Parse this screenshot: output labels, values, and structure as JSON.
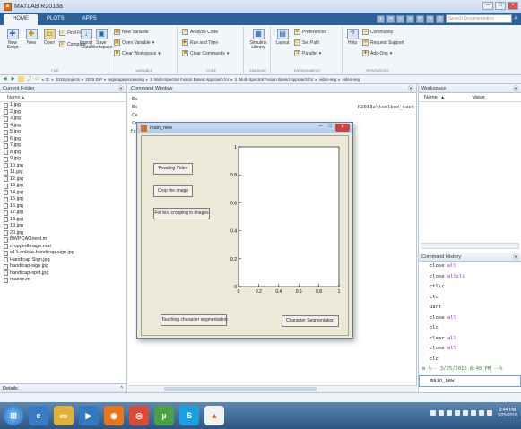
{
  "window": {
    "title": "MATLAB R2013a"
  },
  "tabs": [
    {
      "label": "HOME",
      "active": true
    },
    {
      "label": "PLOTS"
    },
    {
      "label": "APPS"
    }
  ],
  "search": {
    "placeholder": "Search Documentation"
  },
  "ribbon": {
    "new_script": "New Script",
    "new": "New",
    "open": "Open",
    "find_files": "Find Files",
    "compare": "Compare",
    "import_data": "Import Data",
    "save_workspace": "Save Workspace",
    "new_variable": "New Variable",
    "open_variable": "Open Variable",
    "clear_workspace": "Clear Workspace",
    "analyze_code": "Analyze Code",
    "run_and_time": "Run and Time",
    "clear_commands": "Clear Commands",
    "simulink_library": "Simulink Library",
    "layout": "Layout",
    "preferences": "Preferences",
    "set_path": "Set Path",
    "parallel": "Parallel",
    "help": "Help",
    "community": "Community",
    "request_support": "Request Support",
    "add_ons": "Add-Ons",
    "groups": [
      "FILE",
      "VARIABLE",
      "CODE",
      "SIMULINK",
      "ENVIRONMENT",
      "RESOURCES"
    ]
  },
  "address": {
    "crumbs": [
      "D:",
      "2016 projects",
      "2015 DIP",
      "regimageprocessing",
      "3. Multi-Spectral Fusion Based Approach for",
      "3. Multi-Spectral Fusion Based Approach for",
      "video-seg",
      "video-seg"
    ]
  },
  "current_folder": {
    "title": "Current Folder",
    "name_col": "Name",
    "files": [
      "1.jpg",
      "2.jpg",
      "3.jpg",
      "4.jpg",
      "5.jpg",
      "6.jpg",
      "7.jpg",
      "8.jpg",
      "9.jpg",
      "10.jpg",
      "11.jpg",
      "12.jpg",
      "13.jpg",
      "14.jpg",
      "15.jpg",
      "16.jpg",
      "17.jpg",
      "18.jpg",
      "19.jpg",
      "20.jpg",
      "BWPCAOrient.m",
      "croppedImage.mat",
      "e13-anikse-handicap-sign.jpg",
      "Handicap Sign.jpg",
      "handicap-sign.jpg",
      "handicap-spot.jpg",
      "mainm.m"
    ],
    "details": "Details"
  },
  "command_window": {
    "title": "Command Window",
    "lines": [
      "Ex",
      "Ex",
      "Ce",
      "Ce",
      "fx >>"
    ],
    "path_fragment": "R2013a\\toolbox_cact"
  },
  "workspace": {
    "title": "Workspace",
    "name_col": "Name",
    "value_col": "Value"
  },
  "history": {
    "title": "Command History",
    "entries": [
      {
        "cmd": "close",
        "arg": "all"
      },
      {
        "cmd": "close",
        "arg": "allclc"
      },
      {
        "cmd": "ctl\\c",
        "arg": ""
      },
      {
        "cmd": "clc",
        "arg": ""
      },
      {
        "cmd": "uart",
        "arg": ""
      },
      {
        "cmd": "close",
        "arg": "all"
      },
      {
        "cmd": "clc",
        "arg": ""
      },
      {
        "cmd": "clear",
        "arg": "all"
      },
      {
        "cmd": "close",
        "arg": "all"
      },
      {
        "cmd": "clc",
        "arg": ""
      }
    ],
    "session": "%-- 3/25/2016 8:40 PM --%",
    "last": "main_new"
  },
  "figure": {
    "title": "main_new",
    "buttons": {
      "reading_video": "Reading Video",
      "crop_image": "Crop the image",
      "text_cropping": "For text cropping in images",
      "touching_seg": "Touching character segmentation",
      "char_seg": "Character Segmentation"
    }
  },
  "chart_data": {
    "type": "line",
    "title": "",
    "xlabel": "",
    "ylabel": "",
    "xlim": [
      0,
      1
    ],
    "ylim": [
      0,
      1
    ],
    "x_ticks": [
      "0",
      "0.2",
      "0.4",
      "0.6",
      "0.8",
      "1"
    ],
    "y_ticks": [
      "0",
      "0.2",
      "0.4",
      "0.6",
      "0.8",
      "1"
    ],
    "series": []
  },
  "taskbar": {
    "clock_time": "9:44 PM",
    "clock_date": "3/25/2016"
  }
}
